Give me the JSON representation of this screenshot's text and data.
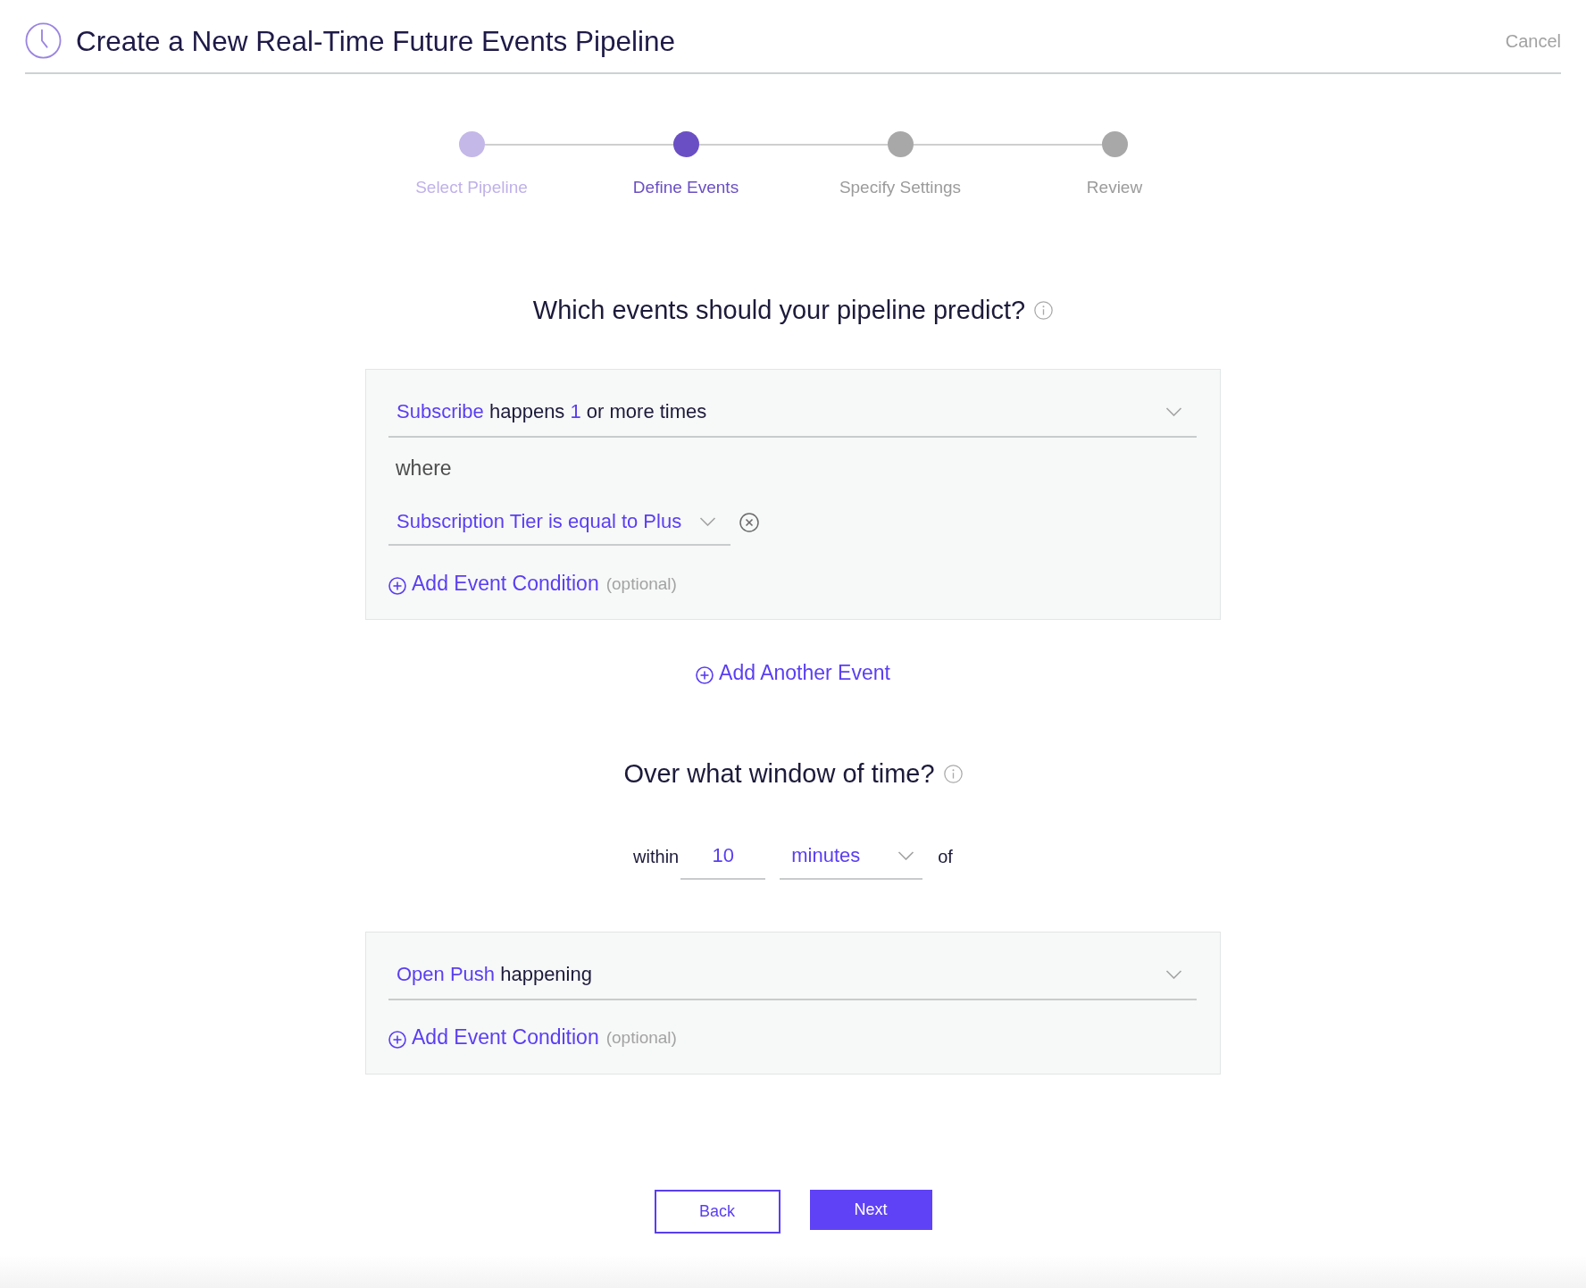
{
  "header": {
    "title": "Create a New Real-Time Future Events Pipeline",
    "cancel": "Cancel"
  },
  "steps": [
    {
      "label": "Select Pipeline",
      "done": true,
      "selected": false
    },
    {
      "label": "Define Events",
      "done": false,
      "selected": true
    },
    {
      "label": "Specify Settings",
      "done": false,
      "selected": false
    },
    {
      "label": "Review",
      "done": false,
      "selected": false
    }
  ],
  "predict": {
    "question": "Which events should your pipeline predict?",
    "event": [
      {
        "text": "Subscribe",
        "kind": "value"
      },
      {
        "text": "happens",
        "kind": "plain"
      },
      {
        "text": "1",
        "kind": "value"
      },
      {
        "text": "or more times",
        "kind": "plain"
      }
    ],
    "where": "where",
    "conditions": [
      {
        "text": "Subscription Tier is equal to Plus"
      }
    ],
    "add_condition": "Add Event Condition",
    "optional": "(optional)"
  },
  "add_event": "Add Another Event",
  "window": {
    "question": "Over what window of time?",
    "prefix": "within",
    "amount": "10",
    "unit": "minutes",
    "suffix": "of"
  },
  "target": {
    "event": [
      {
        "text": "Open Push",
        "kind": "value"
      },
      {
        "text": "happening",
        "kind": "plain"
      }
    ],
    "add_condition": "Add Event Condition",
    "optional": "(optional)"
  },
  "buttons": [
    {
      "label": "Back",
      "kind": "secondary"
    },
    {
      "label": "Next",
      "kind": "primary"
    }
  ]
}
